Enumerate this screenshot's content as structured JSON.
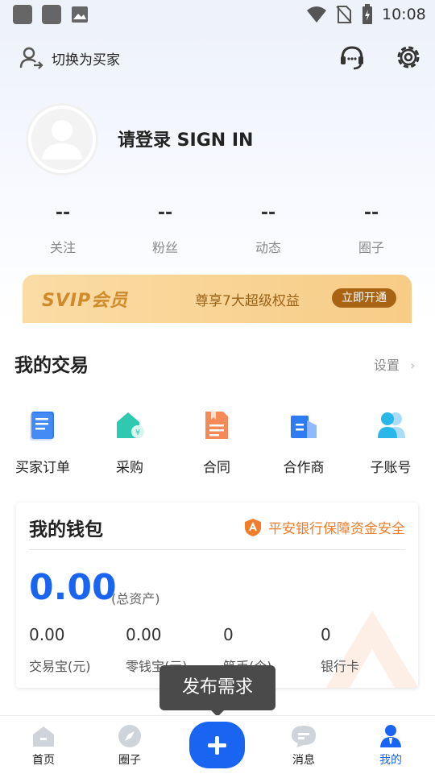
{
  "status_bar": {
    "time": "10:08"
  },
  "header": {
    "switch_label": "切换为买家",
    "login_text": "请登录 SIGN IN",
    "stats": [
      {
        "value": "--",
        "label": "关注"
      },
      {
        "value": "--",
        "label": "粉丝"
      },
      {
        "value": "--",
        "label": "动态"
      },
      {
        "value": "--",
        "label": "圈子"
      }
    ]
  },
  "svip": {
    "logo": "SVIP会员",
    "desc": "尊享7大超级权益",
    "button": "立即开通"
  },
  "trade": {
    "title": "我的交易",
    "settings_label": "设置",
    "items": [
      {
        "label": "买家订单",
        "icon": "document-icon"
      },
      {
        "label": "采购",
        "icon": "purchase-house-icon"
      },
      {
        "label": "合同",
        "icon": "contract-icon"
      },
      {
        "label": "合作商",
        "icon": "partner-building-icon"
      },
      {
        "label": "子账号",
        "icon": "sub-account-icon"
      }
    ]
  },
  "wallet": {
    "title": "我的钱包",
    "security_text": "平安银行保障资金安全",
    "total": "0.00",
    "total_label": "(总资产)",
    "items": [
      {
        "value": "0.00",
        "label": "交易宝(元)"
      },
      {
        "value": "0.00",
        "label": "零钱宝(元)"
      },
      {
        "value": "0",
        "label": "筑币(个)"
      },
      {
        "value": "0",
        "label": "银行卡"
      }
    ]
  },
  "tooltip": "发布需求",
  "tabbar": {
    "items": [
      {
        "label": "首页"
      },
      {
        "label": "圈子"
      },
      {
        "label": "消息"
      },
      {
        "label": "我的"
      }
    ]
  },
  "colors": {
    "accent": "#1a64f2",
    "svip": "#f7cc86",
    "security": "#f07d2b"
  }
}
